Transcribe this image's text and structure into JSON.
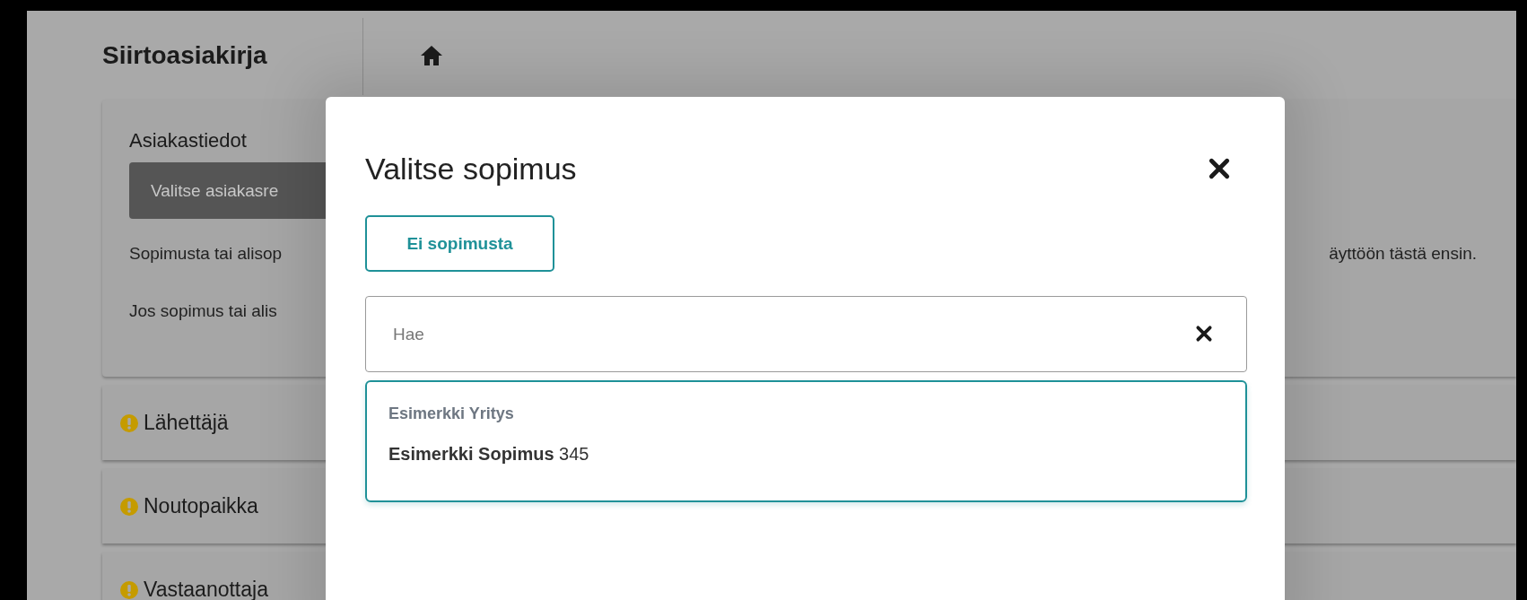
{
  "header": {
    "title": "Siirtoasiakirja"
  },
  "customer_card": {
    "title": "Asiakastiedot",
    "select_button": "Valitse asiakasre",
    "notes": [
      {
        "left": "Sopimusta tai alisop",
        "right": "äyttöön tästä ensin."
      },
      {
        "left": "Jos sopimus tai alis"
      }
    ]
  },
  "sections": [
    {
      "label": "Lähettäjä",
      "warning": true
    },
    {
      "label": "Noutopaikka",
      "warning": true
    },
    {
      "label": "Vastaanottaja",
      "warning": true
    }
  ],
  "dialog": {
    "title": "Valitse sopimus",
    "no_contract_button": "Ei sopimusta",
    "search": {
      "placeholder": "Hae"
    },
    "results": [
      {
        "group": "Esimerkki Yritys",
        "items": [
          {
            "label": "**Esimerkki Sopimus** 345"
          }
        ]
      }
    ]
  }
}
